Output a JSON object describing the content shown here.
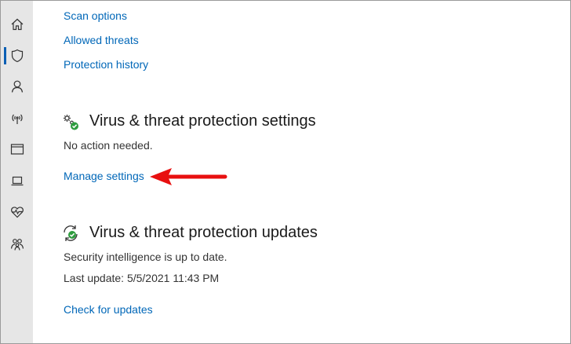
{
  "links": {
    "scan_options": "Scan options",
    "allowed_threats": "Allowed threats",
    "protection_history": "Protection history"
  },
  "settings_section": {
    "heading": "Virus & threat protection settings",
    "status": "No action needed.",
    "manage_link": "Manage settings"
  },
  "updates_section": {
    "heading": "Virus & threat protection updates",
    "status": "Security intelligence is up to date.",
    "last_update": "Last update: 5/5/2021 11:43 PM",
    "check_link": "Check for updates"
  },
  "sidebar": {
    "items": [
      {
        "icon": "home-icon"
      },
      {
        "icon": "shield-icon",
        "active": true
      },
      {
        "icon": "person-icon"
      },
      {
        "icon": "wifi-icon"
      },
      {
        "icon": "app-browser-icon"
      },
      {
        "icon": "laptop-icon"
      },
      {
        "icon": "heart-icon"
      },
      {
        "icon": "family-icon"
      }
    ]
  },
  "colors": {
    "link": "#0067b8",
    "sidebar_bg": "#e6e6e6",
    "arrow": "#e81010",
    "check_badge": "#2e9c3f"
  }
}
